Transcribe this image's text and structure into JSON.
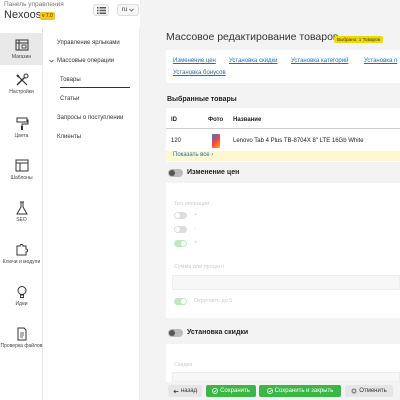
{
  "header": {
    "panel_label": "Панель управления",
    "brand": "Nexoos",
    "version": "v 7.0",
    "lang": "ru"
  },
  "rail": [
    {
      "label": "Магазин",
      "icon": "shop-icon"
    },
    {
      "label": "Настройки",
      "icon": "wrench-screwdriver-icon"
    },
    {
      "label": "Цвета",
      "icon": "paint-roller-icon"
    },
    {
      "label": "Шаблоны",
      "icon": "template-icon"
    },
    {
      "label": "SEO",
      "icon": "flask-icon"
    },
    {
      "label": "Ключи и модули",
      "icon": "puzzle-icon"
    },
    {
      "label": "Идеи",
      "icon": "lightbulb-icon"
    },
    {
      "label": "Проверка файлов",
      "icon": "file-check-icon"
    }
  ],
  "subnav": {
    "labels_mgmt": "Управление ярлыками",
    "bulk_ops": "Массовые операции",
    "products": "Товары",
    "articles": "Статьи",
    "requests": "Запросы о поступлении",
    "clients": "Клиенты"
  },
  "page": {
    "title": "Массовое редактирование товаров",
    "selected_badge": "Выбрано: 1 Товаров"
  },
  "tabs": [
    "Изменение цен",
    "Установка скидки",
    "Установка категорий",
    "Установка п",
    "Установка бонусов"
  ],
  "selected": {
    "title": "Выбранные товары",
    "columns": [
      "ID",
      "Фото",
      "Название"
    ],
    "rows": [
      {
        "id": "120",
        "name": "Lenovo Tab 4 Plus TB-8704X 8\" LTE 16Gb White"
      }
    ],
    "show_all": "Показать все ›"
  },
  "price_change": {
    "title": "Изменение цен",
    "op_type_label": "Тип операции",
    "op_plus": "+",
    "op_minus": "-",
    "op_eq": "=",
    "amount_label": "Сумма или процент",
    "round_label": "Округлить до 5"
  },
  "discount": {
    "title": "Установка скидки",
    "field_label": "Скидка"
  },
  "footer": {
    "back": "назад",
    "save": "Сохранить",
    "save_close": "Сохранить и закрыть",
    "cancel": "Отменить"
  },
  "colors": {
    "accent_green": "#3cb54a",
    "badge_yellow": "#f5d700",
    "link_blue": "#2a6ea6"
  }
}
